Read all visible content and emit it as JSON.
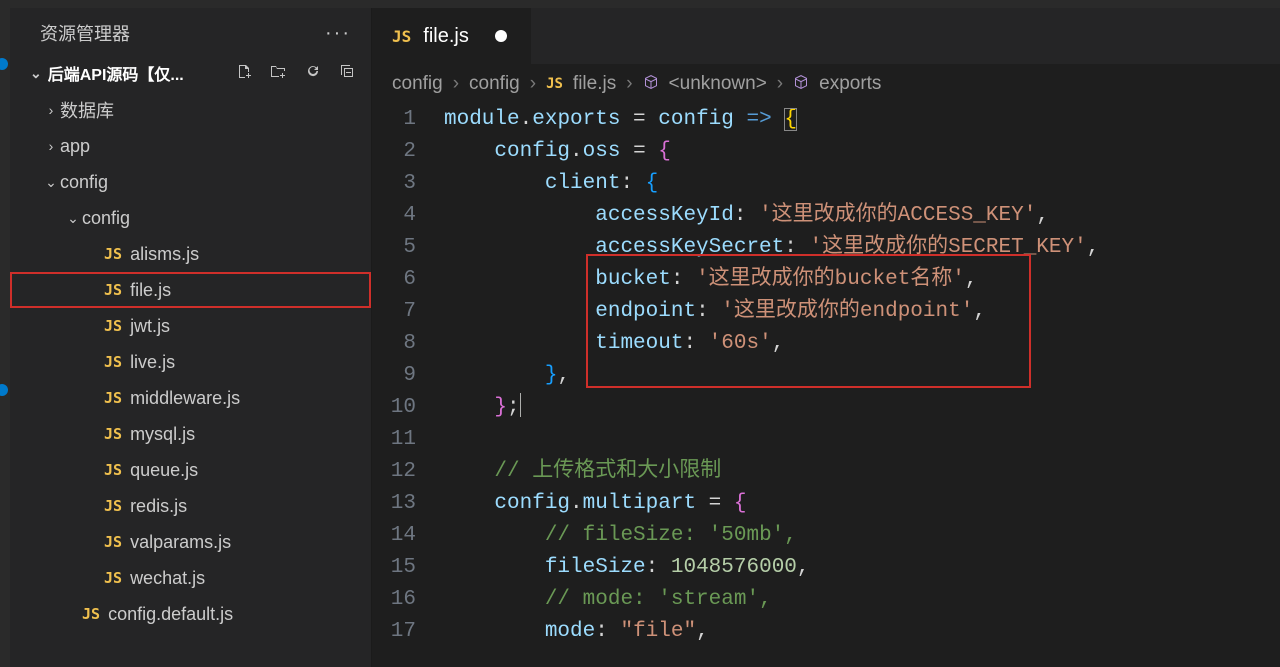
{
  "sidebar": {
    "title": "资源管理器",
    "project_name": "后端API源码【仅...",
    "actions": {
      "new_file": "⊕",
      "new_folder": "📁",
      "refresh": "↻",
      "collapse": "⊟"
    },
    "tree": [
      {
        "kind": "folder",
        "level": 0,
        "expanded": false,
        "name": "数据库"
      },
      {
        "kind": "folder",
        "level": 0,
        "expanded": false,
        "name": "app"
      },
      {
        "kind": "folder",
        "level": 0,
        "expanded": true,
        "name": "config"
      },
      {
        "kind": "folder",
        "level": 1,
        "expanded": true,
        "name": "config"
      },
      {
        "kind": "file",
        "level": 2,
        "name": "alisms.js"
      },
      {
        "kind": "file",
        "level": 2,
        "name": "file.js",
        "selected": true
      },
      {
        "kind": "file",
        "level": 2,
        "name": "jwt.js"
      },
      {
        "kind": "file",
        "level": 2,
        "name": "live.js"
      },
      {
        "kind": "file",
        "level": 2,
        "name": "middleware.js"
      },
      {
        "kind": "file",
        "level": 2,
        "name": "mysql.js"
      },
      {
        "kind": "file",
        "level": 2,
        "name": "queue.js"
      },
      {
        "kind": "file",
        "level": 2,
        "name": "redis.js"
      },
      {
        "kind": "file",
        "level": 2,
        "name": "valparams.js"
      },
      {
        "kind": "file",
        "level": 2,
        "name": "wechat.js"
      },
      {
        "kind": "file",
        "level": 1,
        "name": "config.default.js"
      }
    ]
  },
  "tab": {
    "icon": "JS",
    "name": "file.js",
    "dirty": true
  },
  "breadcrumbs": [
    {
      "label": "config",
      "icon": ""
    },
    {
      "label": "config",
      "icon": ""
    },
    {
      "label": "file.js",
      "icon": "JS"
    },
    {
      "label": "<unknown>",
      "icon": "cube"
    },
    {
      "label": "exports",
      "icon": "cube"
    }
  ],
  "code": {
    "lines": 17,
    "l1_prefix": "module",
    "l1_exports": "exports",
    "l1_config": "config",
    "l2_config": "config",
    "l2_oss": "oss",
    "l3_client": "client",
    "l4_key": "accessKeyId",
    "l4_val": "'这里改成你的ACCESS_KEY'",
    "l5_key": "accessKeySecret",
    "l5_val": "'这里改成你的SECRET_KEY'",
    "l6_key": "bucket",
    "l6_val": "'这里改成你的bucket名称'",
    "l7_key": "endpoint",
    "l7_val": "'这里改成你的endpoint'",
    "l8_key": "timeout",
    "l8_val": "'60s'",
    "l12_comment": "// 上传格式和大小限制",
    "l13_config": "config",
    "l13_multipart": "multipart",
    "l14_comment": "// fileSize: '50mb',",
    "l15_key": "fileSize",
    "l15_val": "1048576000",
    "l16_comment": "// mode: 'stream',",
    "l17_key": "mode",
    "l17_val": "\"file\""
  }
}
